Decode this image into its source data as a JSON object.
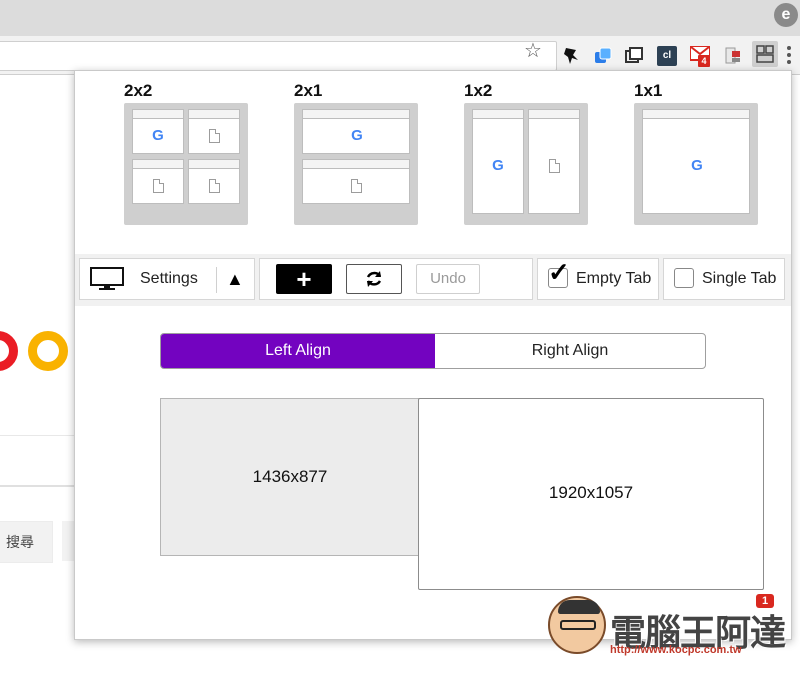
{
  "browser": {
    "profile_initial": "e",
    "extensions": {
      "cl_label": "cl",
      "mail_badge": "4"
    }
  },
  "background_page": {
    "search_button_label": "搜尋",
    "logo_colors": [
      "#ea1d25",
      "#f9b200"
    ]
  },
  "popup": {
    "layouts": [
      {
        "label": "2x2"
      },
      {
        "label": "2x1"
      },
      {
        "label": "1x2"
      },
      {
        "label": "1x1"
      }
    ],
    "controls": {
      "settings_label": "Settings",
      "add_label": "+",
      "undo_label": "Undo",
      "empty_tab_label": "Empty Tab",
      "empty_tab_checked": true,
      "single_tab_label": "Single Tab",
      "single_tab_checked": false
    },
    "align": {
      "left_label": "Left Align",
      "right_label": "Right Align",
      "selected": "left",
      "accent_color": "#7303c0"
    },
    "displays": [
      {
        "label": "1436x877"
      },
      {
        "label": "1920x1057"
      }
    ]
  },
  "watermark": {
    "title": "電腦王阿達",
    "url": "http://www.kocpc.com.tw",
    "badge": "1"
  }
}
